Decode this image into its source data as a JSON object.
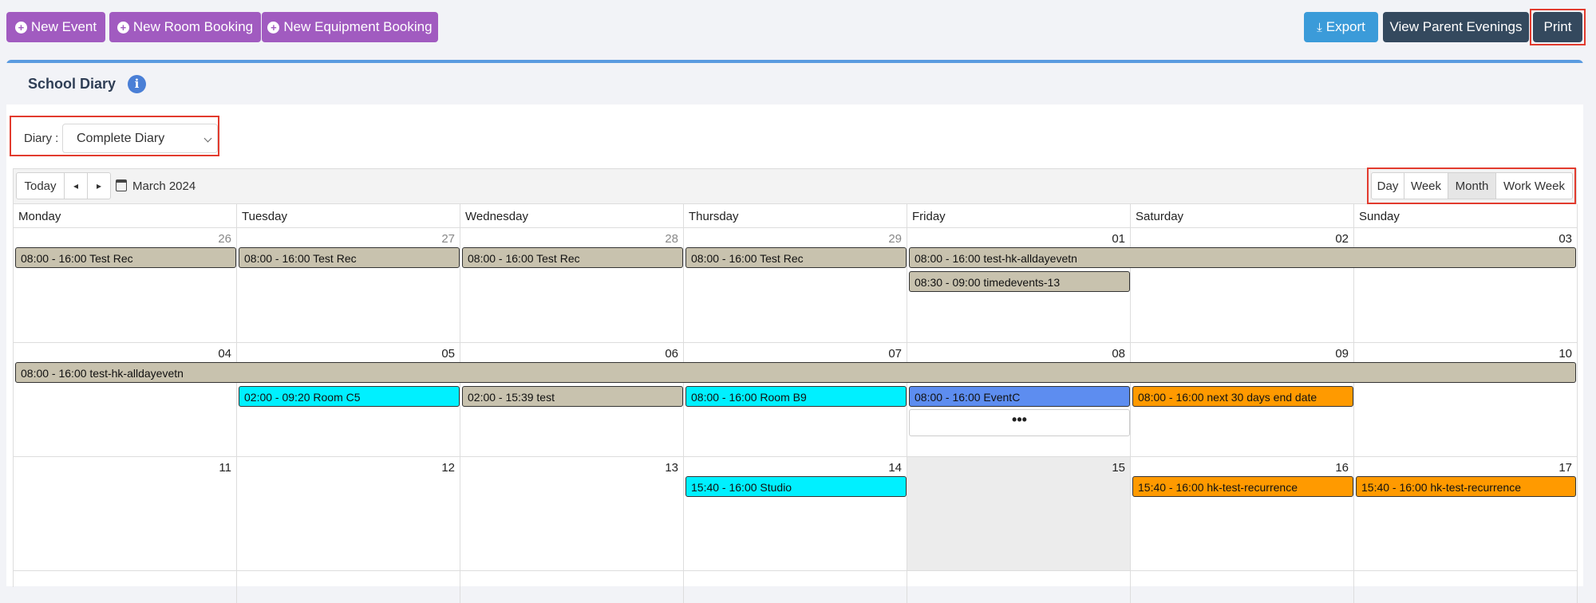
{
  "topbar": {
    "new_event": "New Event",
    "new_room_booking": "New Room Booking",
    "new_equipment_booking": "New Equipment Booking",
    "export": "Export",
    "view_parent_evenings": "View Parent Evenings",
    "print": "Print"
  },
  "panel": {
    "title": "School Diary"
  },
  "diary": {
    "label": "Diary :",
    "selected": "Complete Diary"
  },
  "toolbar": {
    "today": "Today",
    "prev": "◂",
    "next": "▸",
    "month_label": "March 2024",
    "views": [
      "Day",
      "Week",
      "Month",
      "Work Week"
    ],
    "active_view": "Month"
  },
  "calendar": {
    "days_of_week": [
      "Monday",
      "Tuesday",
      "Wednesday",
      "Thursday",
      "Friday",
      "Saturday",
      "Sunday"
    ],
    "weeks": [
      [
        "26",
        "27",
        "28",
        "29",
        "01",
        "02",
        "03"
      ],
      [
        "04",
        "05",
        "06",
        "07",
        "08",
        "09",
        "10"
      ],
      [
        "11",
        "12",
        "13",
        "14",
        "15",
        "16",
        "17"
      ]
    ],
    "events": {
      "w1_mon": "08:00 - 16:00 Test Rec",
      "w1_tue": "08:00 - 16:00 Test Rec",
      "w1_wed": "08:00 - 16:00 Test Rec",
      "w1_thu": "08:00 - 16:00 Test Rec",
      "w1_fri_sun": "08:00 - 16:00 test-hk-alldayevetn",
      "w1_fri_timed": "08:30 - 09:00 timedevents-13",
      "w2_all": "08:00 - 16:00 test-hk-alldayevetn",
      "w2_tue": "02:00 - 09:20 Room C5",
      "w2_wed": "02:00 - 15:39 test",
      "w2_thu": "08:00 - 16:00 Room B9",
      "w2_fri": "08:00 - 16:00 EventC",
      "w2_sat": "08:00 - 16:00 next 30 days end date",
      "w2_more": "•••",
      "w3_thu": "15:40 - 16:00 Studio",
      "w3_sat": "15:40 - 16:00 hk-test-recurrence",
      "w3_sun": "15:40 - 16:00 hk-test-recurrence"
    }
  },
  "colors": {
    "purple": "#a15bc0",
    "blue": "#3b9bd9",
    "dark": "#34495e",
    "event_grey": "#c8c2ae",
    "event_cyan": "#00f0ff",
    "event_blue": "#5d8df0",
    "event_orange": "#ff9a00",
    "highlight_red": "#e23b2e"
  }
}
